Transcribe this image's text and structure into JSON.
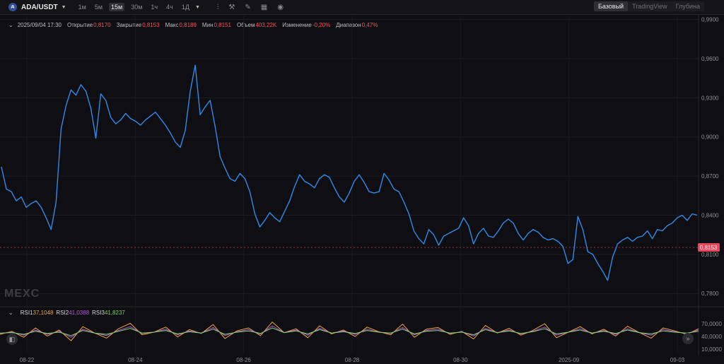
{
  "toolbar": {
    "pair": "ADA/USDT",
    "timeframes": [
      "1м",
      "5м",
      "15м",
      "30м",
      "1ч",
      "4ч",
      "1Д"
    ],
    "active_timeframe": "15м",
    "tool_icons": [
      "indicator-icon",
      "crosshair-icon",
      "pencil-icon",
      "calendar-icon",
      "camera-icon"
    ],
    "views": [
      "Базовый",
      "TradingView",
      "Глубина"
    ],
    "active_view": "Базовый"
  },
  "info": {
    "timestamp": "2025/09/04 17:30",
    "open_label": "Открытие",
    "open": "0,8170",
    "close_label": "Закрытие",
    "close": "0,8153",
    "high_label": "Макс",
    "high": "0,8189",
    "low_label": "Мин",
    "low": "0,8151",
    "volume_label": "Объем",
    "volume": "403,22K",
    "change_label": "Изменение",
    "change": "-0,20%",
    "range_label": "Диапазон",
    "range": "0,47%"
  },
  "watermark": "MEXC",
  "rsi": {
    "rsi1_label": "RSI1",
    "rsi1": "37,1048",
    "rsi2_label": "RSI2",
    "rsi2": "41,0388",
    "rsi3_label": "RSI3",
    "rsi3": "41,8237"
  },
  "colors": {
    "price_line": "#2f8ae8",
    "last_price_badge": "#e8455a",
    "rsi1": "#f2a33a",
    "rsi2": "#b05fd8",
    "rsi3": "#7fd06a",
    "negative": "#f0545d"
  },
  "chart_data": [
    {
      "type": "line",
      "title": "",
      "x_ticks": [
        "08-22",
        "08-24",
        "08-26",
        "08-28",
        "08-30",
        "2025-09",
        "09-03"
      ],
      "y_ticks": [
        "0,7800",
        "0,8100",
        "0,8400",
        "0,8700",
        "0,9000",
        "0,9300",
        "0,9600",
        "0,9900"
      ],
      "ylim": [
        0.772,
        0.993
      ],
      "last_price": "0,8153",
      "series": [
        {
          "values": [
            0.877,
            0.86,
            0.858,
            0.851,
            0.854,
            0.846,
            0.849,
            0.851,
            0.846,
            0.838,
            0.829,
            0.85,
            0.906,
            0.924,
            0.936,
            0.932,
            0.94,
            0.935,
            0.922,
            0.899,
            0.933,
            0.928,
            0.915,
            0.91,
            0.913,
            0.918,
            0.914,
            0.912,
            0.909,
            0.913,
            0.916,
            0.919,
            0.914,
            0.909,
            0.903,
            0.896,
            0.892,
            0.905,
            0.935,
            0.955,
            0.917,
            0.923,
            0.928,
            0.908,
            0.885,
            0.876,
            0.868,
            0.866,
            0.872,
            0.868,
            0.858,
            0.841,
            0.831,
            0.836,
            0.842,
            0.838,
            0.835,
            0.843,
            0.851,
            0.862,
            0.871,
            0.866,
            0.864,
            0.861,
            0.868,
            0.871,
            0.869,
            0.861,
            0.854,
            0.85,
            0.857,
            0.866,
            0.871,
            0.865,
            0.858,
            0.857,
            0.858,
            0.872,
            0.867,
            0.86,
            0.858,
            0.85,
            0.841,
            0.828,
            0.822,
            0.818,
            0.829,
            0.825,
            0.817,
            0.824,
            0.826,
            0.828,
            0.83,
            0.838,
            0.832,
            0.818,
            0.826,
            0.83,
            0.824,
            0.823,
            0.828,
            0.834,
            0.837,
            0.834,
            0.826,
            0.821,
            0.826,
            0.829,
            0.827,
            0.823,
            0.821,
            0.822,
            0.82,
            0.816,
            0.803,
            0.806,
            0.839,
            0.829,
            0.812,
            0.81,
            0.803,
            0.797,
            0.79,
            0.808,
            0.818,
            0.821,
            0.823,
            0.82,
            0.823,
            0.824,
            0.828,
            0.822,
            0.829,
            0.828,
            0.832,
            0.834,
            0.838,
            0.84,
            0.836,
            0.841,
            0.84
          ]
        }
      ]
    },
    {
      "type": "line",
      "title": "RSI",
      "y_ticks": [
        "10,0000",
        "40,0000",
        "70,0000"
      ],
      "ylim": [
        0,
        100
      ],
      "series": [
        {
          "name": "RSI1",
          "values": [
            45,
            52,
            38,
            60,
            41,
            55,
            30,
            63,
            48,
            36,
            58,
            71,
            44,
            50,
            62,
            39,
            56,
            47,
            68,
            35,
            53,
            60,
            42,
            74,
            49,
            58,
            37,
            65,
            46,
            55,
            40,
            62,
            51,
            44,
            69,
            38,
            57,
            61,
            45,
            52,
            34,
            66,
            48,
            59,
            43,
            54,
            70,
            37,
            50,
            63,
            46,
            57,
            41,
            64,
            49,
            36,
            60,
            53,
            45,
            58
          ]
        },
        {
          "name": "RSI2",
          "values": [
            47,
            50,
            43,
            55,
            45,
            52,
            38,
            57,
            48,
            42,
            54,
            63,
            47,
            50,
            57,
            44,
            53,
            48,
            61,
            42,
            51,
            56,
            46,
            65,
            49,
            55,
            43,
            59,
            48,
            53,
            45,
            57,
            50,
            47,
            61,
            44,
            54,
            57,
            47,
            51,
            41,
            59,
            49,
            55,
            46,
            52,
            62,
            43,
            50,
            58,
            48,
            54,
            45,
            58,
            49,
            43,
            56,
            51,
            47,
            55
          ]
        },
        {
          "name": "RSI3",
          "values": [
            48,
            49,
            45,
            52,
            47,
            50,
            42,
            54,
            48,
            45,
            52,
            59,
            48,
            50,
            54,
            46,
            51,
            48,
            57,
            45,
            50,
            53,
            47,
            60,
            49,
            53,
            46,
            56,
            48,
            51,
            47,
            54,
            50,
            48,
            57,
            46,
            52,
            54,
            48,
            50,
            44,
            56,
            49,
            53,
            47,
            51,
            58,
            46,
            50,
            55,
            48,
            52,
            47,
            55,
            49,
            46,
            53,
            50,
            48,
            52
          ]
        }
      ]
    }
  ]
}
